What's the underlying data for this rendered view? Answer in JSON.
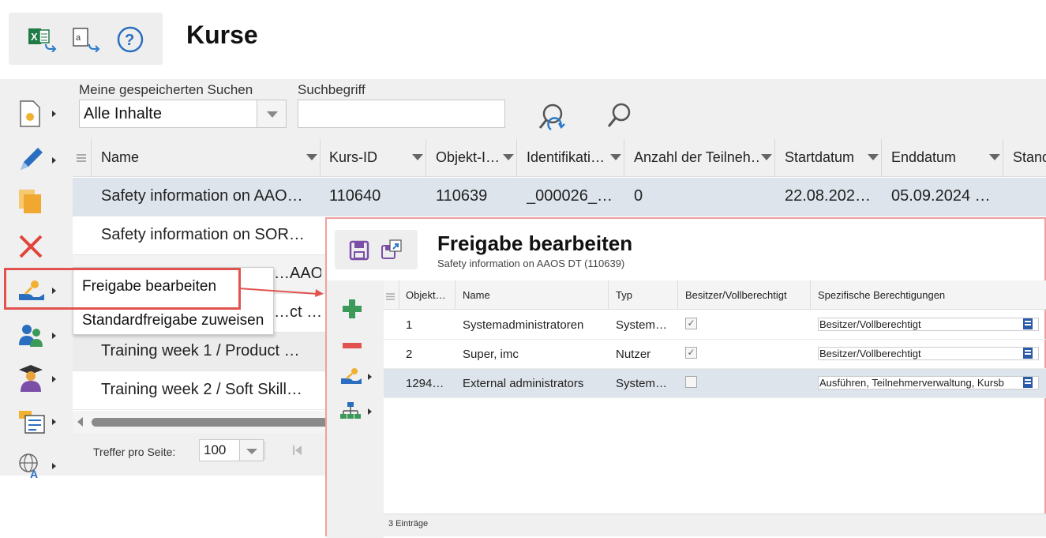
{
  "header": {
    "title": "Kurse",
    "icons": [
      "excel-export-icon",
      "text-export-icon",
      "help-icon"
    ]
  },
  "search": {
    "saved_label": "Meine gespeicherten Suchen",
    "saved_value": "Alle Inhalte",
    "term_label": "Suchbegriff",
    "term_value": "",
    "icons": [
      "reset-search-icon",
      "search-icon"
    ]
  },
  "sidebar": {
    "items": [
      {
        "icon": "new-course-icon",
        "has_submenu": true
      },
      {
        "icon": "edit-icon",
        "has_submenu": true
      },
      {
        "icon": "copy-icon",
        "has_submenu": false
      },
      {
        "icon": "delete-icon",
        "has_submenu": false
      },
      {
        "icon": "share-icon",
        "has_submenu": true
      },
      {
        "icon": "users-icon",
        "has_submenu": true
      },
      {
        "icon": "graduate-icon",
        "has_submenu": true
      },
      {
        "icon": "certificate-icon",
        "has_submenu": true
      },
      {
        "icon": "translate-icon",
        "has_submenu": true
      }
    ]
  },
  "grid": {
    "columns": [
      "Name",
      "Kurs-ID",
      "Objekt-I…",
      "Identifikati…",
      "Anzahl der Teilneh…",
      "Startdatum",
      "Enddatum",
      "Stand"
    ],
    "rows": [
      {
        "name": "Safety information on AAO…",
        "kurs_id": "110640",
        "objekt_id": "110639",
        "ident": "_000026_…",
        "anzahl": "0",
        "start": "22.08.202…",
        "end": "05.09.2024 …",
        "selected": true
      },
      {
        "name": "Safety information on SOR…",
        "kurs_id": "",
        "objekt_id": "",
        "ident": "",
        "anzahl": "",
        "start": "",
        "end": "",
        "selected": false
      },
      {
        "name": "…AAO…",
        "kurs_id": "",
        "objekt_id": "",
        "ident": "",
        "anzahl": "",
        "start": "",
        "end": "",
        "selected": false
      },
      {
        "name": "…ct …",
        "kurs_id": "",
        "objekt_id": "",
        "ident": "",
        "anzahl": "",
        "start": "",
        "end": "",
        "selected": false
      },
      {
        "name": "Training week 1 / Product …",
        "kurs_id": "",
        "objekt_id": "",
        "ident": "",
        "anzahl": "",
        "start": "",
        "end": "",
        "selected": false
      },
      {
        "name": "Training week 2 / Soft Skill…",
        "kurs_id": "",
        "objekt_id": "",
        "ident": "",
        "anzahl": "",
        "start": "",
        "end": "",
        "selected": false
      }
    ],
    "footer": {
      "per_page_label": "Treffer pro Seite:",
      "per_page_value": "100"
    }
  },
  "context_menu": {
    "items": [
      "Freigabe bearbeiten",
      "Standardfreigabe zuweisen"
    ]
  },
  "dialog": {
    "title": "Freigabe bearbeiten",
    "subtitle": "Safety information on AAOS DT (110639)",
    "toolbar_icons": [
      "save-icon",
      "save-as-icon"
    ],
    "side_icons": [
      "add-icon",
      "remove-icon",
      "share-icon",
      "hierarchy-icon"
    ],
    "columns": [
      "Objekt…",
      "Name",
      "Typ",
      "Besitzer/Vollberechtigt",
      "Spezifische Berechtigungen"
    ],
    "rows": [
      {
        "id": "1",
        "name": "Systemadministratoren",
        "typ": "System…",
        "owner": true,
        "perm": "Besitzer/Vollberechtigt",
        "selected": false
      },
      {
        "id": "2",
        "name": "Super, imc",
        "typ": "Nutzer",
        "owner": true,
        "perm": "Besitzer/Vollberechtigt",
        "selected": false
      },
      {
        "id": "1294…",
        "name": "External administrators",
        "typ": "System…",
        "owner": false,
        "perm": "Ausführen, Teilnehmerverwaltung, Kursb",
        "selected": true
      }
    ],
    "count": "3 Einträge"
  },
  "colors": {
    "selected_row": "#dde4ec",
    "highlight_red": "#e0534f",
    "accent_blue": "#2a5aa8",
    "add_green": "#3b9a5a",
    "remove_red": "#e0534f",
    "delete_red": "#e0453a",
    "save_purple": "#7b4fa8"
  }
}
